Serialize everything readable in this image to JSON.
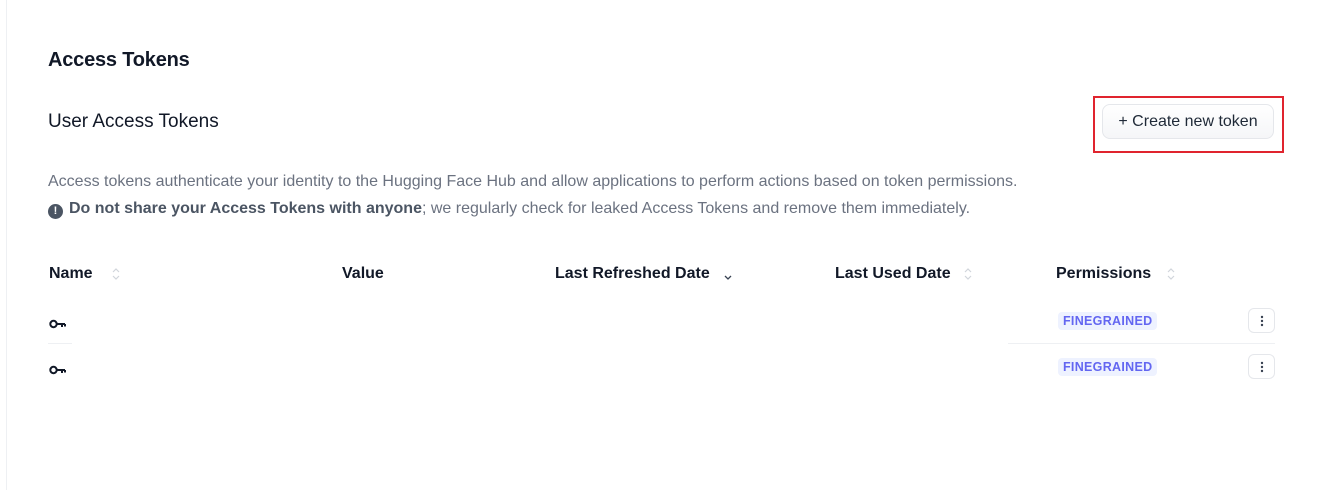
{
  "header": {
    "page_title": "Access Tokens",
    "section_title": "User Access Tokens",
    "create_button_label": "+ Create new token"
  },
  "description": {
    "line1": "Access tokens authenticate your identity to the Hugging Face Hub and allow applications to perform actions based on token permissions.",
    "warning_bold": "Do not share your Access Tokens with anyone",
    "warning_rest": "; we regularly check for leaked Access Tokens and remove them immediately."
  },
  "table": {
    "columns": {
      "name": "Name",
      "value": "Value",
      "last_refreshed": "Last Refreshed Date",
      "last_used": "Last Used Date",
      "permissions": "Permissions"
    },
    "rows": [
      {
        "name": "",
        "value": "",
        "last_refreshed": "",
        "last_used": "",
        "permission": "FINEGRAINED",
        "icon": "key-icon"
      },
      {
        "name": "",
        "value": "",
        "last_refreshed": "",
        "last_used": "",
        "permission": "FINEGRAINED",
        "icon": "key-icon"
      }
    ]
  },
  "colors": {
    "highlight": "#e0242e",
    "badge_text": "#6366f1",
    "badge_bg": "#eef2ff"
  }
}
